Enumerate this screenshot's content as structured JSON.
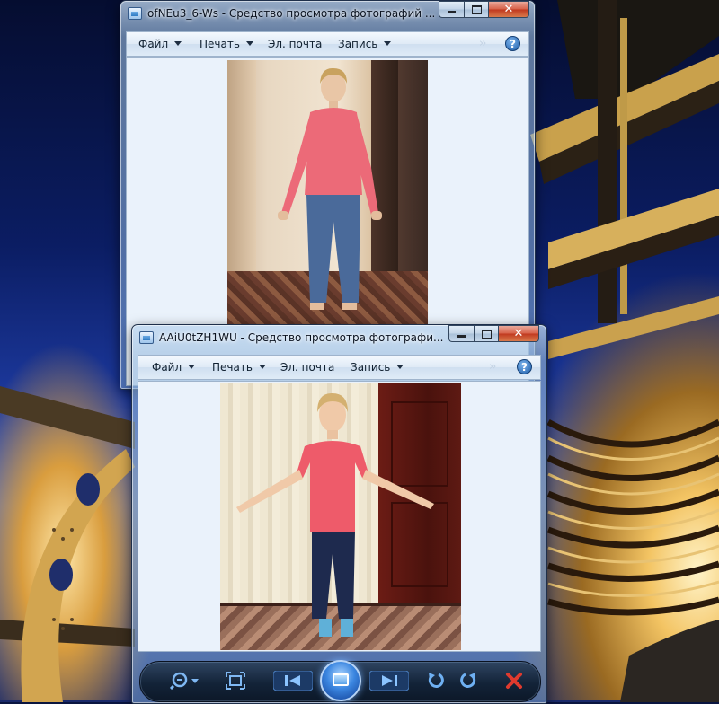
{
  "window_top": {
    "title": "ofNEu3_6-Ws - Средство просмотра фотографий ...",
    "menu": {
      "file": "Файл",
      "print": "Печать",
      "email": "Эл. почта",
      "burn": "Запись"
    },
    "help_label": "?"
  },
  "window_bottom": {
    "title": "AAiU0tZH1WU - Средство просмотра фотографи...",
    "menu": {
      "file": "Файл",
      "print": "Печать",
      "email": "Эл. почта",
      "burn": "Запись"
    },
    "help_label": "?"
  },
  "caption_buttons": {
    "close": "✕"
  },
  "toolbar": {
    "icons": [
      "zoom-icon",
      "fit-to-window-icon",
      "previous-icon",
      "slideshow-icon",
      "next-icon",
      "rotate-left-icon",
      "rotate-right-icon",
      "delete-icon"
    ]
  },
  "colors": {
    "accent": "#3b86e0",
    "close_red": "#c0391f",
    "delete_red": "#e03a2e"
  }
}
